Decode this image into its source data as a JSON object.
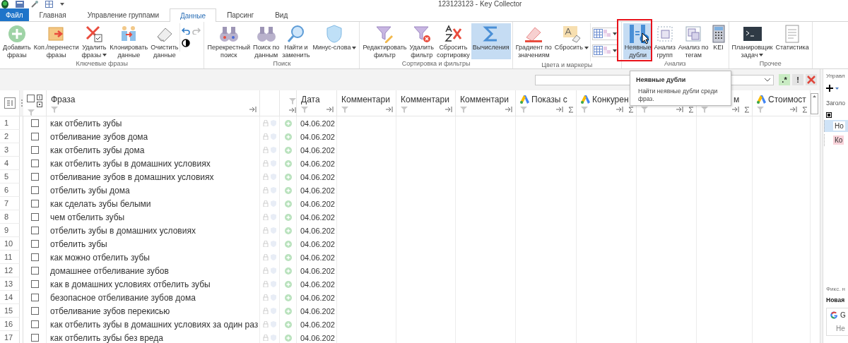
{
  "window": {
    "title": "123123123 - Key Collector"
  },
  "tabs": [
    {
      "label": "Файл",
      "kind": "file",
      "selected": false
    },
    {
      "label": "Главная",
      "kind": "tab",
      "selected": false
    },
    {
      "label": "Управление группами",
      "kind": "tab",
      "selected": false
    },
    {
      "label": "Данные",
      "kind": "tab",
      "selected": true
    },
    {
      "label": "Парсинг",
      "kind": "tab",
      "selected": false
    },
    {
      "label": "Вид",
      "kind": "tab",
      "selected": false
    }
  ],
  "ribbon": {
    "groups": [
      {
        "label": "Ключевые фразы",
        "buttons": [
          {
            "label": "Добавить\nфразы",
            "dropdown": false,
            "highlighted": false
          },
          {
            "label": "Коп./перенести\nфразы",
            "dropdown": false,
            "highlighted": false
          },
          {
            "label": "Удалить\nфразы",
            "dropdown": true,
            "highlighted": false
          },
          {
            "label": "Клонировать\nданные",
            "dropdown": false,
            "highlighted": false
          },
          {
            "label": "Очистить\nданные",
            "dropdown": false,
            "highlighted": false
          }
        ]
      },
      {
        "label": "Поиск",
        "buttons": [
          {
            "label": "Перекрестный\nпоиск",
            "dropdown": false,
            "highlighted": false
          },
          {
            "label": "Поиск по\nданным",
            "dropdown": false,
            "highlighted": false
          },
          {
            "label": "Найти и\nзаменить",
            "dropdown": false,
            "highlighted": false
          },
          {
            "label": "Минус-слова",
            "dropdown": true,
            "highlighted": false
          }
        ]
      },
      {
        "label": "Сортировка и фильтры",
        "buttons": [
          {
            "label": "Редактировать\nфильтр",
            "dropdown": false,
            "highlighted": false
          },
          {
            "label": "Удалить\nфильтр",
            "dropdown": false,
            "highlighted": false
          },
          {
            "label": "Сбросить\nсортировку",
            "dropdown": false,
            "highlighted": false
          },
          {
            "label": "Вычисления",
            "dropdown": false,
            "highlighted": true
          }
        ]
      },
      {
        "label": "Цвета и маркеры",
        "buttons": [
          {
            "label": "Градиент по\nзначениям",
            "dropdown": false,
            "highlighted": false
          },
          {
            "label": "Сбросить",
            "dropdown": true,
            "highlighted": false
          }
        ]
      },
      {
        "label": "Анализ",
        "buttons": [
          {
            "label": "Неявные\nдубли",
            "dropdown": false,
            "highlighted": true
          },
          {
            "label": "Анализ\nгрупп",
            "dropdown": false,
            "highlighted": false
          },
          {
            "label": "Анализ по\nтегам",
            "dropdown": false,
            "highlighted": false
          },
          {
            "label": "KEI",
            "dropdown": false,
            "highlighted": false
          }
        ]
      },
      {
        "label": "Прочее",
        "buttons": [
          {
            "label": "Планировщик\nзадач",
            "dropdown": true,
            "highlighted": false
          },
          {
            "label": "Статистика",
            "dropdown": false,
            "highlighted": false
          }
        ]
      }
    ]
  },
  "filter_bar": {
    "buttons": [
      ".*",
      "!"
    ]
  },
  "tooltip": {
    "title": "Неявные дубли",
    "text": "Найти неявные дубли среди фраз."
  },
  "table": {
    "select_all": {
      "checked": false
    },
    "columns": [
      {
        "kind": "phrase",
        "label": "Фраза"
      },
      {
        "kind": "flags"
      },
      {
        "kind": "status"
      },
      {
        "kind": "text",
        "label": "Дата"
      },
      {
        "kind": "text",
        "label": "Комментари"
      },
      {
        "kind": "text",
        "label": "Комментари"
      },
      {
        "kind": "text",
        "label": "Комментари"
      },
      {
        "kind": "ads",
        "label": "Показы с",
        "sum": true
      },
      {
        "kind": "ads",
        "label": "Конкурен",
        "sum": true
      },
      {
        "kind": "metric",
        "sum": true
      },
      {
        "kind": "metric",
        "label": "м",
        "sum": true
      },
      {
        "kind": "ads",
        "label": "Стоимост",
        "sum": true
      }
    ],
    "rows": [
      {
        "num": "1",
        "checked": false,
        "phrase": "как отбелить зубы",
        "date": "04.06.202"
      },
      {
        "num": "2",
        "checked": false,
        "phrase": "отбеливание зубов дома",
        "date": "04.06.202"
      },
      {
        "num": "3",
        "checked": false,
        "phrase": "как отбелить зубы дома",
        "date": "04.06.202"
      },
      {
        "num": "4",
        "checked": false,
        "phrase": "как отбелить зубы в домашних условиях",
        "date": "04.06.202"
      },
      {
        "num": "5",
        "checked": false,
        "phrase": "отбеливание зубов в домашних условиях",
        "date": "04.06.202"
      },
      {
        "num": "6",
        "checked": false,
        "phrase": "отбелить зубы дома",
        "date": "04.06.202"
      },
      {
        "num": "7",
        "checked": false,
        "phrase": "как сделать зубы белыми",
        "date": "04.06.202"
      },
      {
        "num": "8",
        "checked": false,
        "phrase": "чем отбелить зубы",
        "date": "04.06.202"
      },
      {
        "num": "9",
        "checked": false,
        "phrase": "отбелить зубы в домашних условиях",
        "date": "04.06.202"
      },
      {
        "num": "10",
        "checked": false,
        "phrase": "отбелить зубы",
        "date": "04.06.202"
      },
      {
        "num": "11",
        "checked": false,
        "phrase": "как можно отбелить зубы",
        "date": "04.06.202"
      },
      {
        "num": "12",
        "checked": false,
        "phrase": "домашнее отбеливание зубов",
        "date": "04.06.202"
      },
      {
        "num": "13",
        "checked": false,
        "phrase": "как в домашних условиях отбелить зубы",
        "date": "04.06.202"
      },
      {
        "num": "14",
        "checked": false,
        "phrase": "безопасное отбеливание зубов дома",
        "date": "04.06.202"
      },
      {
        "num": "15",
        "checked": false,
        "phrase": "отбеливание зубов перекисью",
        "date": "04.06.202"
      },
      {
        "num": "16",
        "checked": false,
        "phrase": "как отбелить зубы в домашних условиях за один раз",
        "date": "04.06.202"
      },
      {
        "num": "17",
        "checked": false,
        "phrase": "как отбелить зубы без вреда",
        "date": "04.06.202"
      }
    ]
  },
  "side_panel": {
    "title": "Управл",
    "header": "Заголо",
    "tree": [
      {
        "label": "Но",
        "selected": true,
        "color": "#ffffff"
      },
      {
        "label": "Ко",
        "selected": false,
        "color": "#f9d3da"
      }
    ],
    "fixed_label": "Фикс. н",
    "section_title": "Новая",
    "card": {
      "title": "G",
      "text": "Не"
    }
  }
}
